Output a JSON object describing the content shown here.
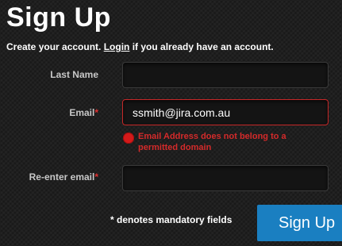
{
  "header": {
    "title": "Sign Up"
  },
  "intro": {
    "prefix": "Create your account. ",
    "login_link": "Login",
    "suffix": " if you already have an account."
  },
  "form": {
    "last_name": {
      "label": "Last Name",
      "value": ""
    },
    "email": {
      "label": "Email",
      "required_marker": "*",
      "value": "ssmith@jira.com.au",
      "error": "Email Address does not belong to a permitted domain"
    },
    "reenter_email": {
      "label": "Re-enter email",
      "required_marker": "*",
      "value": ""
    },
    "mandatory_note": "* denotes mandatory fields",
    "submit_label": "Sign Up"
  },
  "colors": {
    "background": "#1f1f1f",
    "error": "#d42a2a",
    "button": "#1a7fc1"
  },
  "icons": {
    "error_icon": "error-circle"
  }
}
